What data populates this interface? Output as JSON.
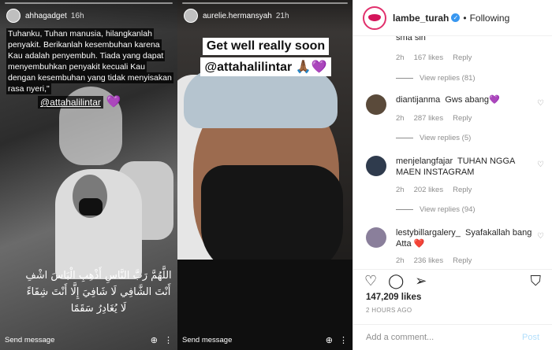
{
  "stories": {
    "story1": {
      "username": "ahhagadget",
      "time": "16h",
      "caption": "Tuhanku, Tuhan manusia, hilangkanlah penyakit. Berikanlah kesembuhan karena Kau adalah penyembuh. Tiada yang dapat menyembuhkan penyakit kecuali Kau dengan kesembuhan yang tidak menyisakan rasa nyeri,\"",
      "mention": "@attahalilintar",
      "mention_emoji": "💜",
      "arabic_prayer": "اللَّهُمَّ رَبَّ النَّاسِ أَذْهِبِ الْبَاسَ اشْفِ أَنْتَ الشَّافِي لَا شَافِيَ إِلَّا أَنْتَ شِفَاءً لَا يُغَادِرُ سَقَمًا",
      "send_message": "Send message"
    },
    "story2": {
      "username": "aurelie.hermansyah",
      "time": "21h",
      "line1": "Get well really soon",
      "line2": "@attahalilintar 🙏🏾💜",
      "send_message": "Send message"
    }
  },
  "post": {
    "username": "lambe_turah",
    "verified_icon": "✓",
    "follow_status": "Following",
    "comments": [
      {
        "partial_text": "sma sih",
        "time": "2h",
        "likes": "167 likes",
        "reply": "Reply",
        "view_replies": "View replies (81)"
      },
      {
        "username": "diantijanma",
        "text": "Gws abang💜",
        "time": "2h",
        "likes": "287 likes",
        "reply": "Reply",
        "view_replies": "View replies (5)"
      },
      {
        "username": "menjelangfajar",
        "text": "TUHAN NGGA MAEN INSTAGRAM",
        "time": "2h",
        "likes": "202 likes",
        "reply": "Reply",
        "view_replies": "View replies (94)"
      },
      {
        "username": "lestybillargalery_",
        "text": "Syafakallah bang Atta ❤️",
        "time": "2h",
        "likes": "236 likes",
        "reply": "Reply"
      }
    ],
    "likes_count": "147,209 likes",
    "date": "2 HOURS AGO",
    "add_comment_placeholder": "Add a comment...",
    "post_button": "Post"
  },
  "icons": {
    "heart": "♡",
    "comment": "◯",
    "share": "➢",
    "save": "⛉",
    "dots": "···"
  }
}
